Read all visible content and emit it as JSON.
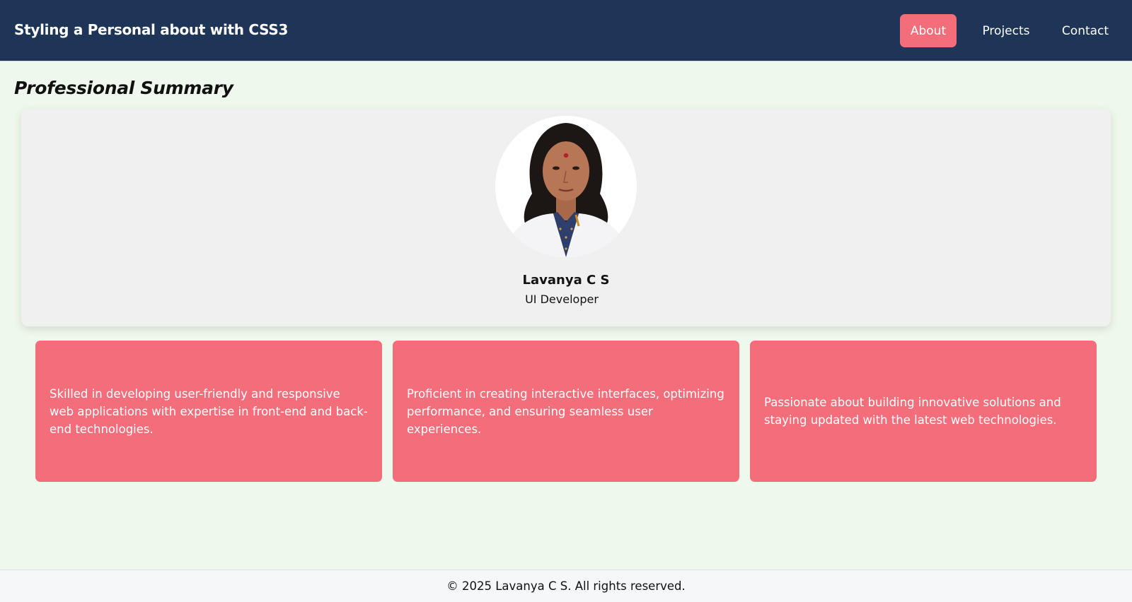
{
  "header": {
    "title": "Styling a Personal about with CSS3",
    "nav": [
      {
        "label": "About",
        "active": true
      },
      {
        "label": "Projects",
        "active": false
      },
      {
        "label": "Contact",
        "active": false
      }
    ]
  },
  "main": {
    "section_title": "Professional Summary",
    "profile": {
      "name": "Lavanya C S",
      "role": "UI Developer"
    },
    "cards": [
      {
        "text": "Skilled in developing user-friendly and responsive web applications with expertise in front-end and back-end technologies."
      },
      {
        "text": "Proficient in creating interactive interfaces, optimizing performance, and ensuring seamless user experiences."
      },
      {
        "text": "Passionate about building innovative solutions and staying updated with the latest web technologies."
      }
    ]
  },
  "footer": {
    "text": "© 2025 Lavanya C S. All rights reserved."
  },
  "colors": {
    "navbar": "#1f3557",
    "accent": "#f36e7a",
    "background": "#eff8ec",
    "card": "#f0f0f0"
  }
}
